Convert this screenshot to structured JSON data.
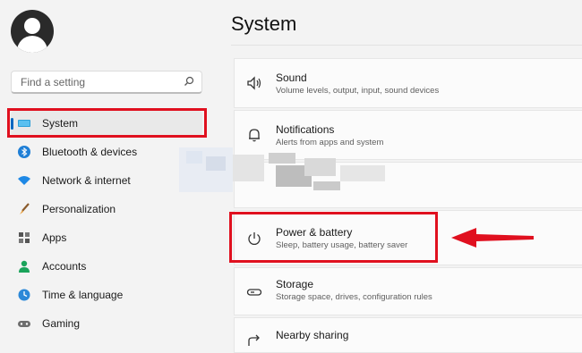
{
  "sidebar": {
    "search_placeholder": "Find a setting",
    "items": [
      {
        "label": "System",
        "icon": "monitor-icon"
      },
      {
        "label": "Bluetooth & devices",
        "icon": "bluetooth-icon"
      },
      {
        "label": "Network & internet",
        "icon": "wifi-icon"
      },
      {
        "label": "Personalization",
        "icon": "brush-icon"
      },
      {
        "label": "Apps",
        "icon": "apps-icon"
      },
      {
        "label": "Accounts",
        "icon": "person-icon"
      },
      {
        "label": "Time & language",
        "icon": "clock-globe-icon"
      },
      {
        "label": "Gaming",
        "icon": "gamepad-icon"
      }
    ],
    "selected_index": 0
  },
  "main": {
    "title": "System",
    "settings": [
      {
        "title": "Sound",
        "subtitle": "Volume levels, output, input, sound devices",
        "icon": "speaker-icon"
      },
      {
        "title": "Notifications",
        "subtitle": "Alerts from apps and system",
        "icon": "bell-icon"
      },
      {
        "title": "Power & battery",
        "subtitle": "Sleep, battery usage, battery saver",
        "icon": "power-icon"
      },
      {
        "title": "Storage",
        "subtitle": "Storage space, drives, configuration rules",
        "icon": "storage-icon"
      },
      {
        "title": "Nearby sharing",
        "subtitle": "",
        "icon": "share-icon"
      }
    ]
  },
  "annotations": {
    "highlight_color": "#e0101f",
    "accent_color": "#0067c0"
  }
}
